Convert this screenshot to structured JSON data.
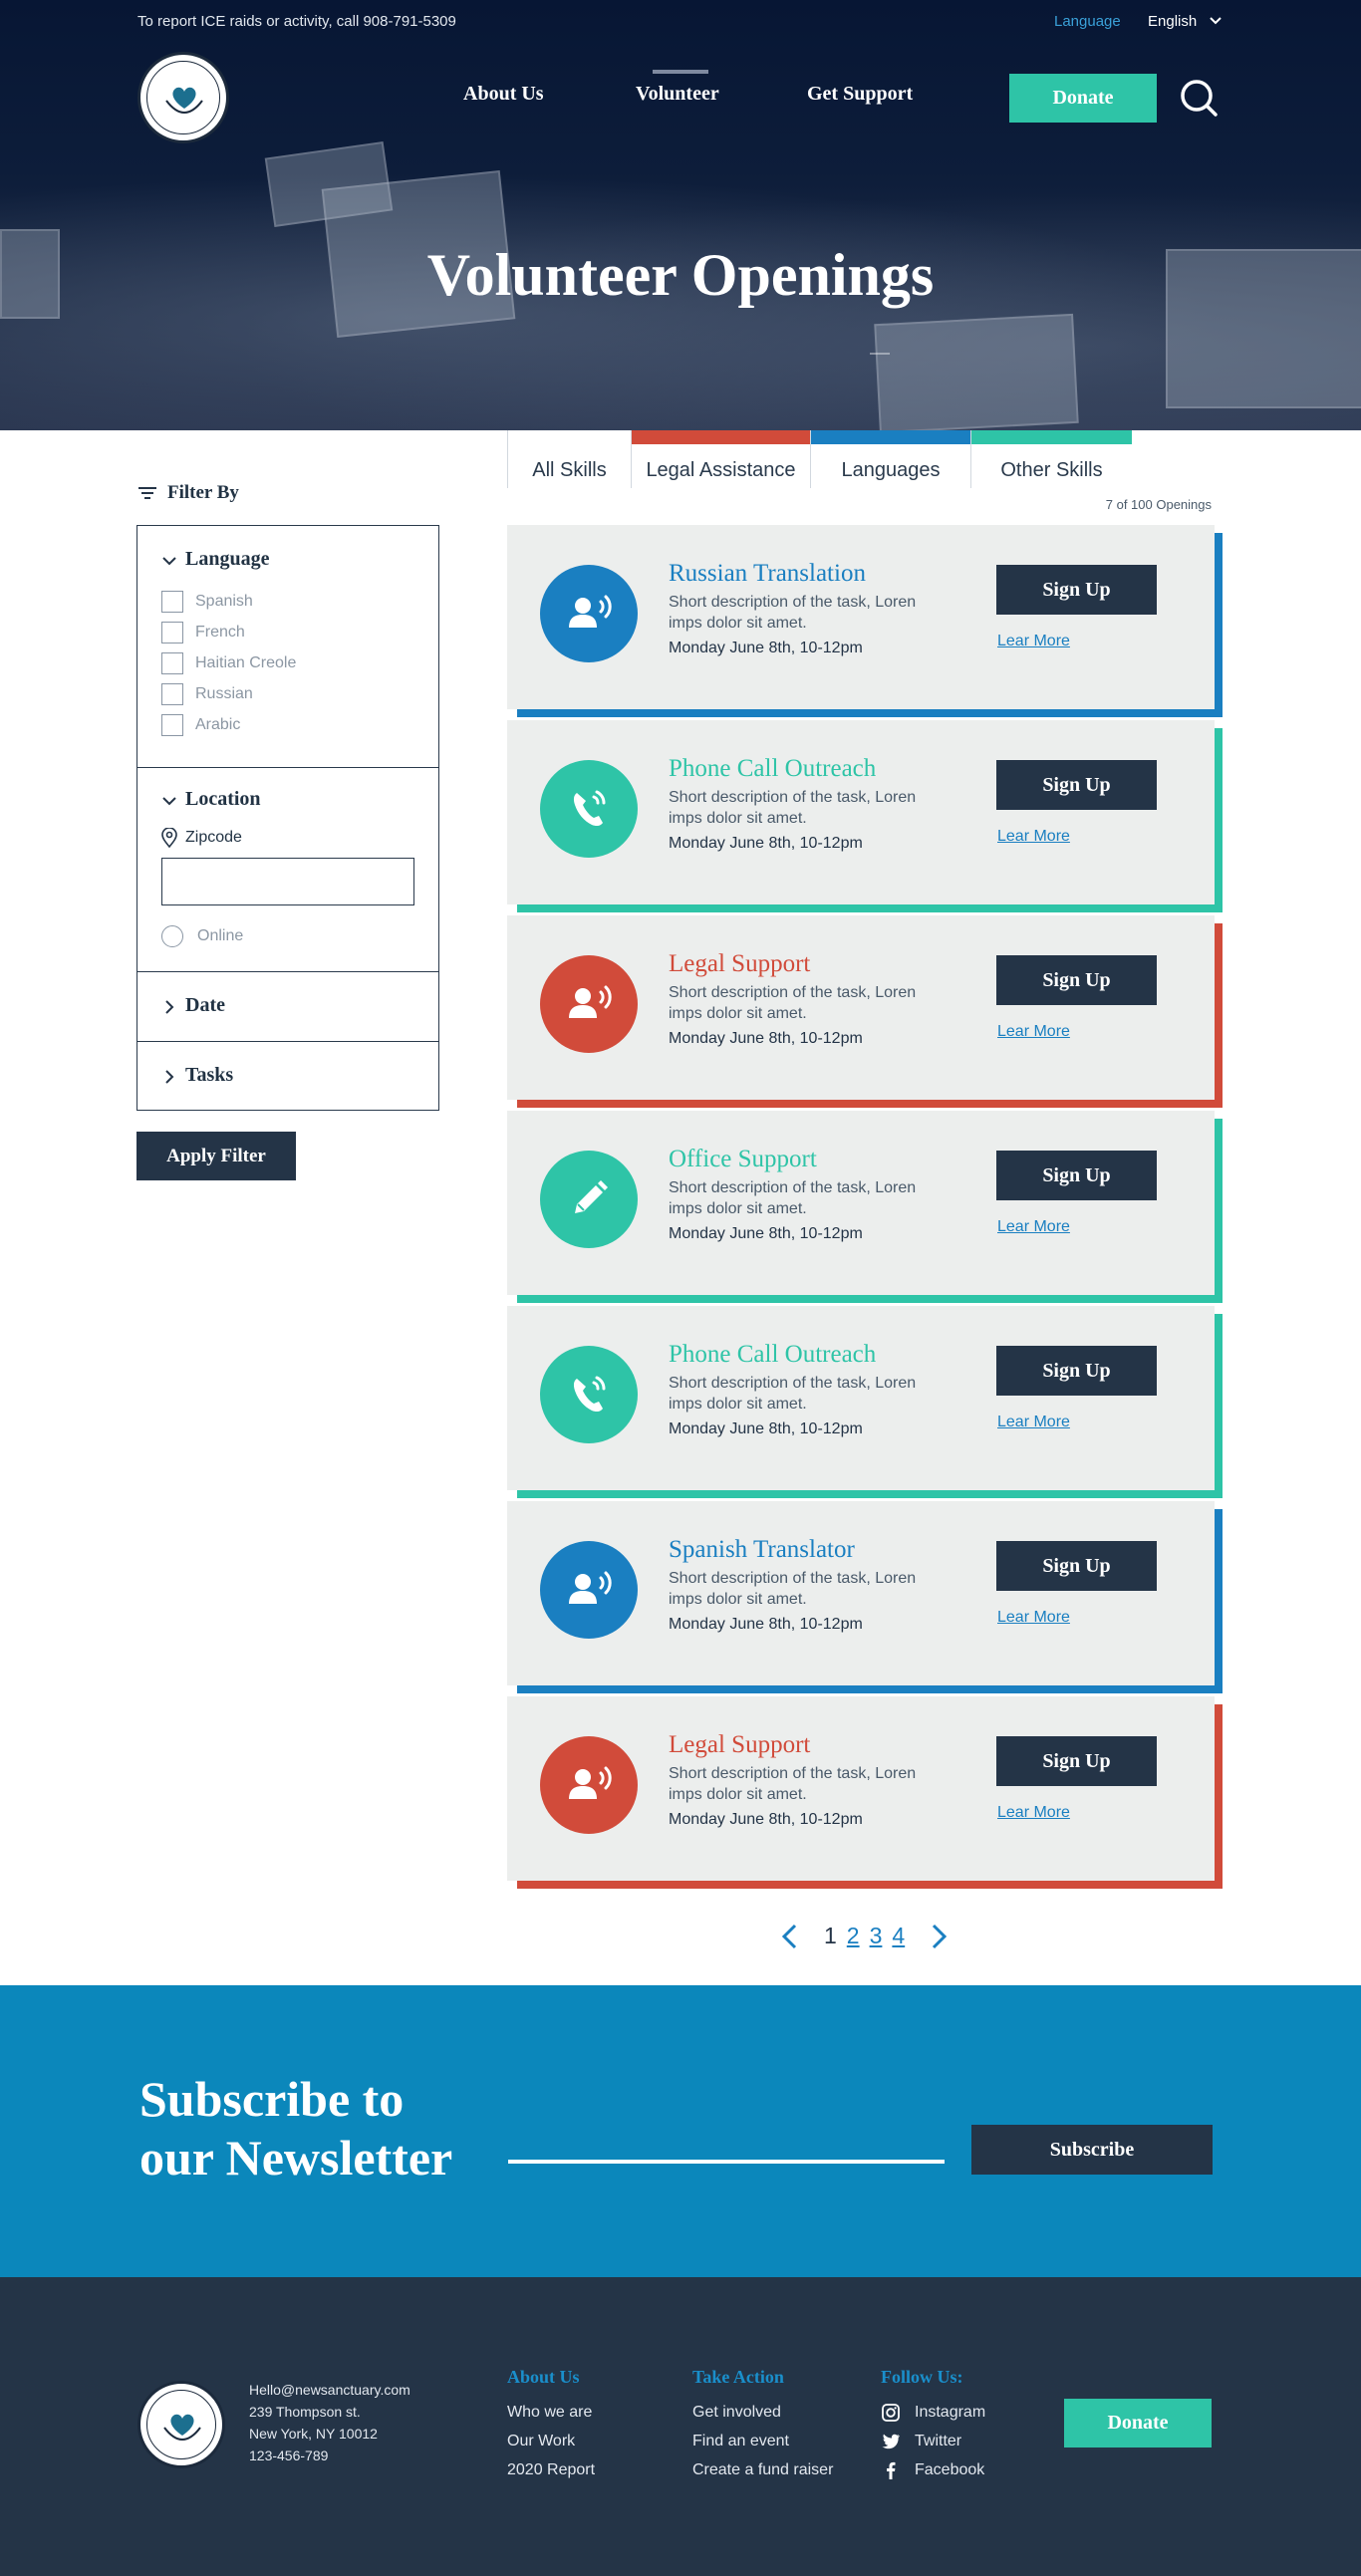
{
  "topbar": {
    "report_text": "To report ICE raids or activity, call 908-791-5309",
    "language_label": "Language",
    "language_value": "English"
  },
  "nav": {
    "items": [
      "About Us",
      "Volunteer",
      "Get Support"
    ],
    "active": "Volunteer",
    "donate_label": "Donate"
  },
  "hero": {
    "title": "Volunteer Openings"
  },
  "filter": {
    "heading": "Filter By",
    "sections": {
      "language": {
        "title": "Language",
        "options": [
          "Spanish",
          "French",
          "Haitian Creole",
          "Russian",
          "Arabic"
        ]
      },
      "location": {
        "title": "Location",
        "zipcode_label": "Zipcode",
        "zipcode_value": "",
        "online_label": "Online"
      },
      "date": {
        "title": "Date"
      },
      "tasks": {
        "title": "Tasks"
      }
    },
    "apply_label": "Apply Filter"
  },
  "tabs": [
    {
      "label": "All Skills",
      "color": ""
    },
    {
      "label": "Legal Assistance",
      "color": "#d14b3a"
    },
    {
      "label": "Languages",
      "color": "#1a7fc1"
    },
    {
      "label": "Other Skills",
      "color": "#2ec4a7"
    }
  ],
  "openings_count": "7 of 100 Openings",
  "openings": [
    {
      "title": "Russian Translation",
      "description": "Short description of the task,  Loren imps dolor sit amet.",
      "date": "Monday June 8th, 10-12pm",
      "signup": "Sign Up",
      "learn": "Lear More",
      "color": "#1a7fc1",
      "icon": "speaking-person-icon"
    },
    {
      "title": "Phone Call Outreach",
      "description": "Short description of the task,  Loren imps dolor sit amet.",
      "date": "Monday June 8th, 10-12pm",
      "signup": "Sign Up",
      "learn": "Lear More",
      "color": "#2ec4a7",
      "icon": "phone-icon"
    },
    {
      "title": "Legal Support",
      "description": "Short description of the task,  Loren imps dolor sit amet.",
      "date": "Monday June 8th, 10-12pm",
      "signup": "Sign Up",
      "learn": "Lear More",
      "color": "#d14b3a",
      "icon": "speaking-person-icon"
    },
    {
      "title": "Office Support",
      "description": "Short description of the task,  Loren imps dolor sit amet.",
      "date": "Monday June 8th, 10-12pm",
      "signup": "Sign Up",
      "learn": "Lear More",
      "color": "#2ec4a7",
      "icon": "pencil-icon"
    },
    {
      "title": "Phone Call Outreach",
      "description": "Short description of the task,  Loren imps dolor sit amet.",
      "date": "Monday June 8th, 10-12pm",
      "signup": "Sign Up",
      "learn": "Lear More",
      "color": "#2ec4a7",
      "icon": "phone-icon"
    },
    {
      "title": "Spanish Translator",
      "description": "Short description of the task,  Loren imps dolor sit amet.",
      "date": "Monday June 8th, 10-12pm",
      "signup": "Sign Up",
      "learn": "Lear More",
      "color": "#1a7fc1",
      "icon": "speaking-person-icon"
    },
    {
      "title": "Legal Support",
      "description": "Short description of the task,  Loren imps dolor sit amet.",
      "date": "Monday June 8th, 10-12pm",
      "signup": "Sign Up",
      "learn": "Lear More",
      "color": "#d14b3a",
      "icon": "speaking-person-icon"
    }
  ],
  "pagination": {
    "current": "1",
    "pages": [
      "2",
      "3",
      "4"
    ]
  },
  "newsletter": {
    "title_line1": "Subscribe to",
    "title_line2": "our Newsletter",
    "subscribe_label": "Subscribe"
  },
  "footer": {
    "contact": [
      "Hello@newsanctuary.com",
      "239 Thompson st.",
      "New York, NY 10012",
      "123-456-789"
    ],
    "columns": [
      {
        "title": "About Us",
        "links": [
          "Who we are",
          "Our Work",
          "2020 Report"
        ]
      },
      {
        "title": "Take Action",
        "links": [
          "Get involved",
          "Find an event",
          "Create a fund raiser"
        ]
      }
    ],
    "follow": {
      "title": "Follow Us:",
      "links": [
        "Instagram",
        "Twitter",
        "Facebook"
      ]
    },
    "donate_label": "Donate"
  },
  "colors": {
    "navy": "#243447",
    "teal": "#2ec4a7",
    "blue": "#1a7fc1",
    "red": "#d14b3a",
    "newsletter_bg": "#0b87bb"
  }
}
